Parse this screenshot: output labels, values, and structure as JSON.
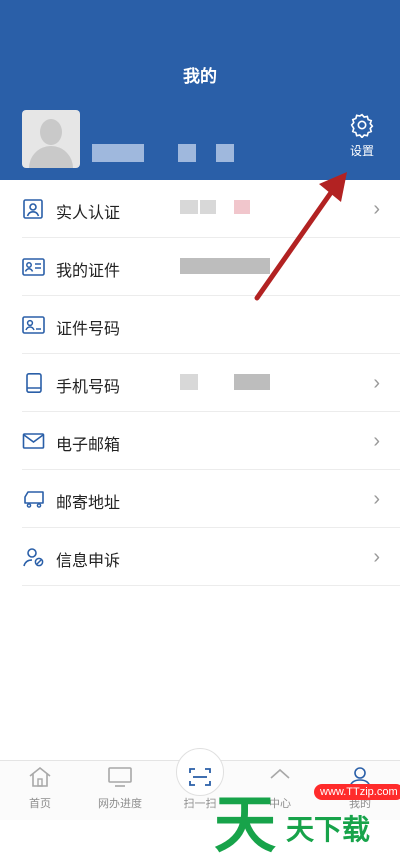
{
  "header": {
    "title": "我的",
    "settings_label": "设置"
  },
  "menu": [
    {
      "label": "实人认证",
      "icon": "id-card-icon",
      "chevron": true
    },
    {
      "label": "我的证件",
      "icon": "document-card-icon",
      "chevron": false
    },
    {
      "label": "证件号码",
      "icon": "id-number-icon",
      "chevron": false
    },
    {
      "label": "手机号码",
      "icon": "phone-icon",
      "chevron": true
    },
    {
      "label": "电子邮箱",
      "icon": "mail-icon",
      "chevron": true
    },
    {
      "label": "邮寄地址",
      "icon": "truck-icon",
      "chevron": true
    },
    {
      "label": "信息申诉",
      "icon": "user-appeal-icon",
      "chevron": true
    }
  ],
  "tabbar": [
    {
      "label": "首页",
      "icon": "home-icon"
    },
    {
      "label": "网办进度",
      "icon": "monitor-icon"
    },
    {
      "label": "扫一扫",
      "icon": "scan-icon"
    },
    {
      "label": "中心",
      "icon": "service-icon"
    },
    {
      "label": "我的",
      "icon": "user-icon"
    }
  ],
  "watermark": {
    "big": "天",
    "small": "天下载",
    "url": "www.TTzip.com"
  },
  "colors": {
    "header": "#2a5fa8",
    "icon": "#2a5fa8",
    "arrow": "#b22222",
    "watermark": "#17a34a"
  }
}
